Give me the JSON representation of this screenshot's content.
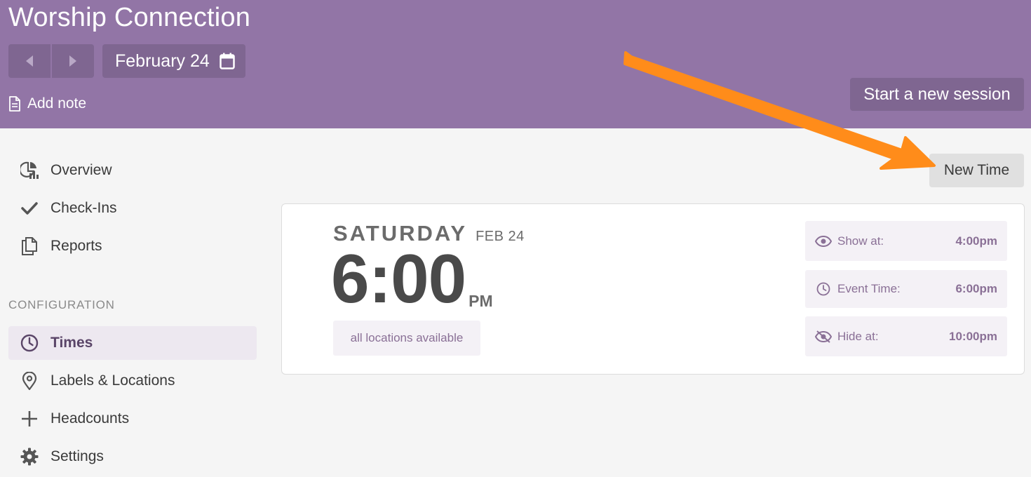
{
  "header": {
    "app_title": "Worship Connection",
    "date_label": "February 24",
    "add_note_label": "Add note",
    "start_session_label": "Start a new session",
    "nav": {
      "prev_icon": "caret-left-icon",
      "next_icon": "caret-right-icon",
      "calendar_icon": "calendar-icon"
    }
  },
  "sidebar": {
    "items": [
      {
        "label": "Overview",
        "icon": "chart-icon"
      },
      {
        "label": "Check-Ins",
        "icon": "check-icon"
      },
      {
        "label": "Reports",
        "icon": "documents-icon"
      }
    ],
    "config_heading": "CONFIGURATION",
    "config_items": [
      {
        "label": "Times",
        "icon": "clock-icon",
        "active": true
      },
      {
        "label": "Labels & Locations",
        "icon": "map-pin-icon"
      },
      {
        "label": "Headcounts",
        "icon": "plus-icon"
      },
      {
        "label": "Settings",
        "icon": "gear-icon"
      }
    ]
  },
  "main": {
    "new_time_label": "New Time",
    "event": {
      "day_name": "SATURDAY",
      "day_date": "FEB 24",
      "time": "6:00",
      "ampm": "PM",
      "locations": "all locations available",
      "details": [
        {
          "label": "Show at:",
          "value": "4:00pm",
          "icon": "eye-icon"
        },
        {
          "label": "Event Time:",
          "value": "6:00pm",
          "icon": "clock-icon"
        },
        {
          "label": "Hide at:",
          "value": "10:00pm",
          "icon": "eye-slash-icon"
        }
      ]
    }
  },
  "colors": {
    "header_bg": "#9275a6",
    "header_button_bg": "#7f6691",
    "accent_text": "#8a7096",
    "annotation_arrow": "#ff8c1a"
  }
}
